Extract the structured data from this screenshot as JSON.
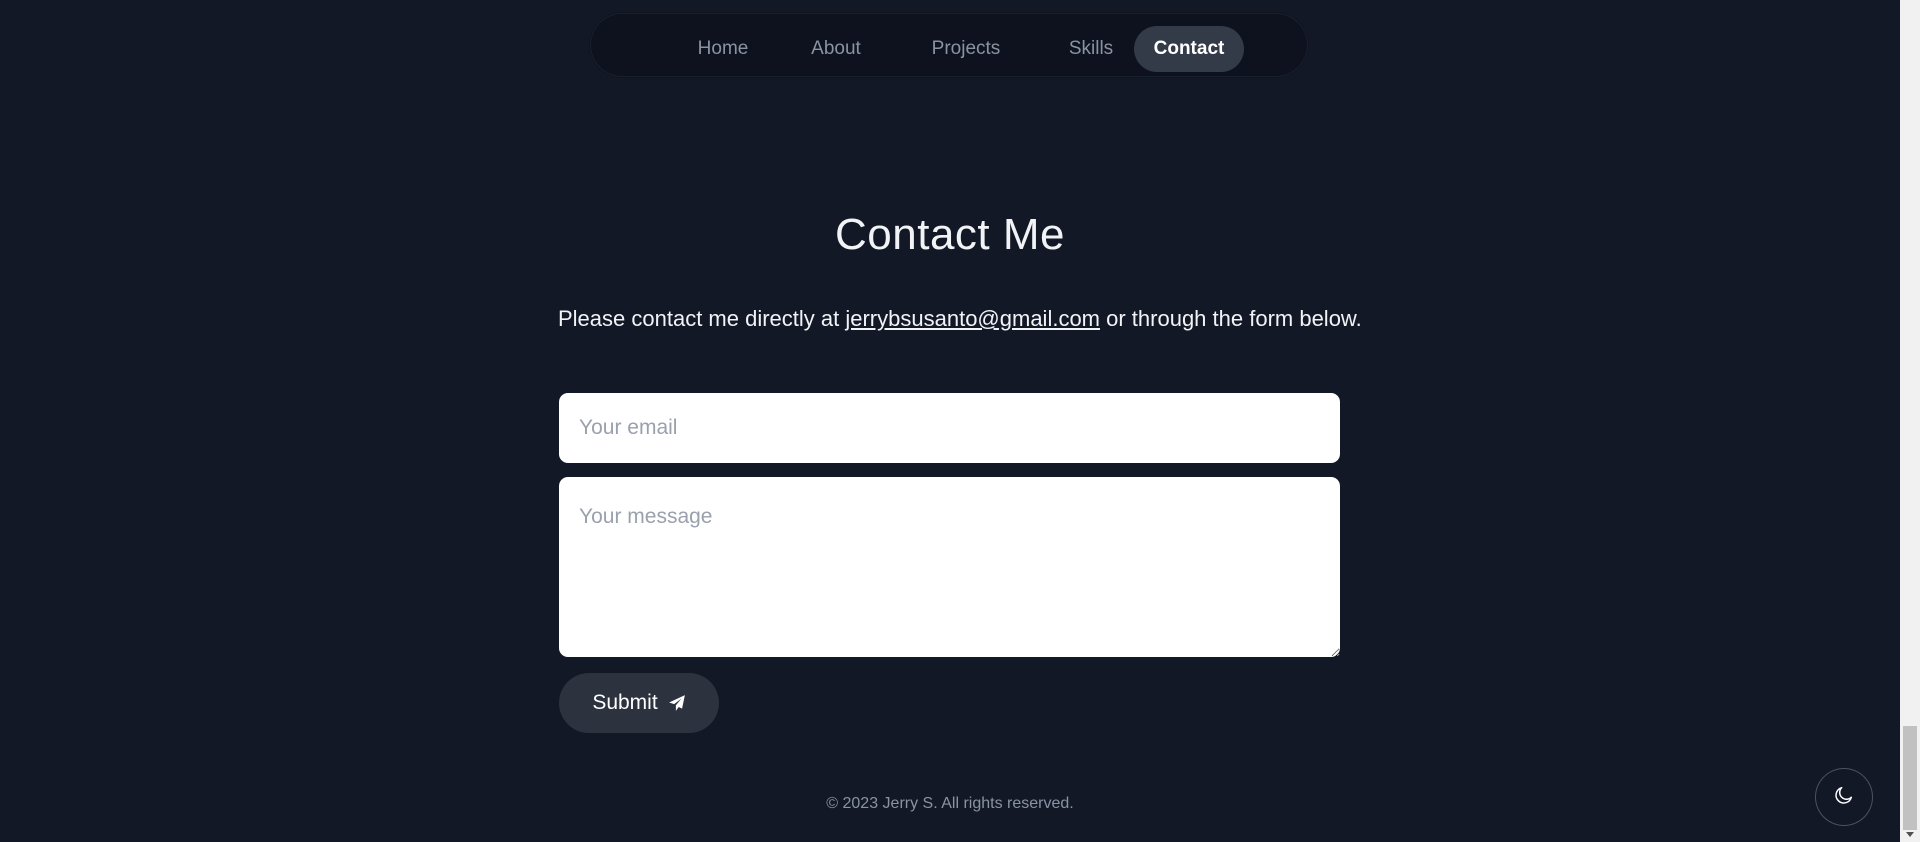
{
  "nav": {
    "items": [
      {
        "label": "Home",
        "active": false
      },
      {
        "label": "About",
        "active": false
      },
      {
        "label": "Projects",
        "active": false
      },
      {
        "label": "Skills",
        "active": false
      },
      {
        "label": "Contact",
        "active": true
      }
    ]
  },
  "contact": {
    "title": "Contact Me",
    "intro_before": "Please contact me directly at ",
    "email_link": "jerrybsusanto@gmail.com",
    "intro_after": " or through the form below.",
    "email_placeholder": "Your email",
    "message_placeholder": "Your message",
    "submit_label": "Submit",
    "submit_icon": "paper-plane-icon"
  },
  "footer": {
    "text": "© 2023 Jerry S. All rights reserved."
  },
  "theme_toggle": {
    "icon": "moon-icon"
  },
  "colors": {
    "background": "#121826",
    "nav_active": "#343b48",
    "button": "#2c323e",
    "text": "#f1f3f6",
    "muted": "#8a93a3"
  }
}
